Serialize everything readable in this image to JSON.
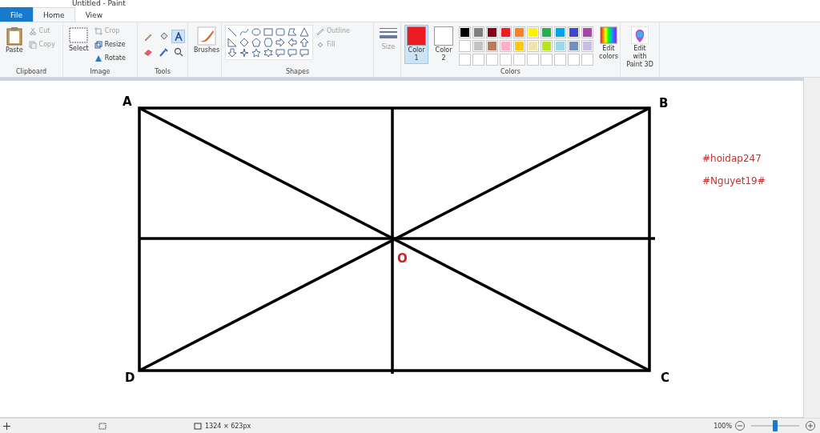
{
  "window": {
    "title": "Untitled - Paint"
  },
  "tabs": [
    {
      "label": "File",
      "kind": "file",
      "selected": false
    },
    {
      "label": "Home",
      "kind": "tab",
      "selected": true
    },
    {
      "label": "View",
      "kind": "tab",
      "selected": false
    }
  ],
  "clipboard": {
    "paste": "Paste",
    "cut": {
      "label": "Cut",
      "disabled": true
    },
    "copy": {
      "label": "Copy",
      "disabled": true
    },
    "group": "Clipboard"
  },
  "image": {
    "select": "Select",
    "crop": {
      "label": "Crop",
      "disabled": true
    },
    "resize": "Resize",
    "rotate": "Rotate",
    "group": "Image"
  },
  "tools": {
    "group": "Tools",
    "items": [
      {
        "kind": "pencil",
        "selected": false
      },
      {
        "kind": "fill",
        "selected": false
      },
      {
        "kind": "text",
        "selected": true
      },
      {
        "kind": "eraser",
        "selected": false
      },
      {
        "kind": "picker",
        "selected": false
      },
      {
        "kind": "magnifier",
        "selected": false
      }
    ]
  },
  "brushes": "Brushes",
  "shapes": {
    "group": "Shapes",
    "outline": {
      "label": "Outline",
      "disabled": true
    },
    "fill": {
      "label": "Fill",
      "disabled": true
    }
  },
  "size": {
    "label": "Size",
    "disabled": true
  },
  "colors": {
    "group": "Colors",
    "color1": {
      "label": "Color",
      "number": "1",
      "color": "#ed1c24",
      "selected": true
    },
    "color2": {
      "label": "Color",
      "number": "2",
      "color": "#ffffff",
      "selected": false
    },
    "palette": [
      [
        {
          "color": "#000000"
        },
        {
          "color": "#7f7f7f"
        },
        {
          "color": "#880015"
        },
        {
          "color": "#ed1c24"
        },
        {
          "color": "#ff7f27"
        },
        {
          "color": "#fff200"
        },
        {
          "color": "#22b14c"
        },
        {
          "color": "#00a2e8"
        },
        {
          "color": "#3f48cc"
        },
        {
          "color": "#a349a4"
        }
      ],
      [
        {
          "color": "#ffffff"
        },
        {
          "color": "#c3c3c3"
        },
        {
          "color": "#b97a57"
        },
        {
          "color": "#ffaec9"
        },
        {
          "color": "#ffc90e"
        },
        {
          "color": "#efe4b0"
        },
        {
          "color": "#b5e61d"
        },
        {
          "color": "#99d9ea"
        },
        {
          "color": "#7092be"
        },
        {
          "color": "#c8bfe7"
        }
      ]
    ],
    "edit_colors": [
      "Edit",
      "colors"
    ]
  },
  "paint3d": [
    "Edit with",
    "Paint 3D"
  ],
  "canvas": {
    "labels": {
      "a": "A",
      "b": "B",
      "c": "C",
      "d": "D",
      "o": "O"
    },
    "notes": [
      "#hoidap247",
      "#Nguyet19#"
    ]
  },
  "status_bar": {
    "dimensions": "1324 × 623px",
    "zoom": "100%",
    "zoom_level": {
      "level": 0.5
    }
  }
}
